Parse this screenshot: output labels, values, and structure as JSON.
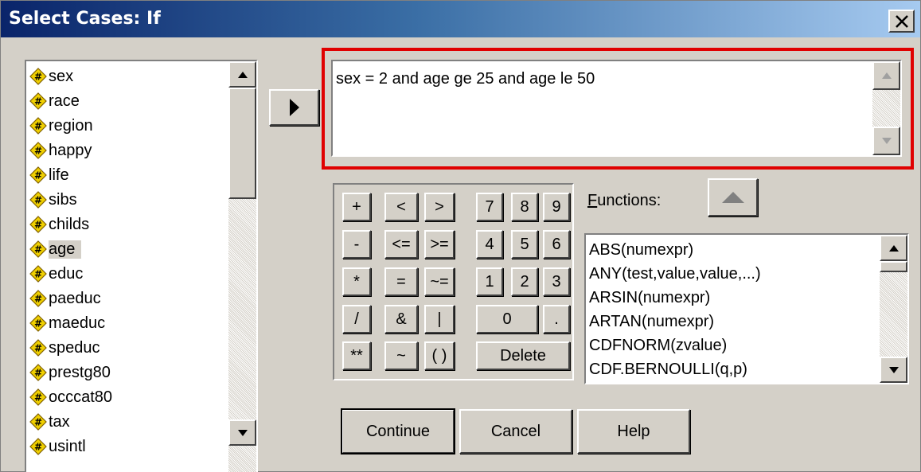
{
  "window": {
    "title": "Select Cases: If"
  },
  "variables": [
    "sex",
    "race",
    "region",
    "happy",
    "life",
    "sibs",
    "childs",
    "age",
    "educ",
    "paeduc",
    "maeduc",
    "speduc",
    "prestg80",
    "occcat80",
    "tax",
    "usintl"
  ],
  "selected_variable": "age",
  "expression": {
    "value": "sex = 2 and age ge 25 and age le 50"
  },
  "keypad": {
    "keys": [
      "+",
      "<",
      ">",
      "7",
      "8",
      "9",
      "-",
      "<=",
      ">=",
      "4",
      "5",
      "6",
      "*",
      "=",
      "~=",
      "1",
      "2",
      "3",
      "/",
      "&",
      "|",
      "0",
      ".",
      "**",
      "~",
      "( )",
      "Delete"
    ]
  },
  "functions": {
    "label": "Functions:",
    "items": [
      "ABS(numexpr)",
      "ANY(test,value,value,...)",
      "ARSIN(numexpr)",
      "ARTAN(numexpr)",
      "CDFNORM(zvalue)",
      "CDF.BERNOULLI(q,p)"
    ]
  },
  "buttons": {
    "continue": "Continue",
    "cancel": "Cancel",
    "help": "Help"
  },
  "colors": {
    "title_start": "#0a246a",
    "title_end": "#a6caf0",
    "highlight": "#e00000",
    "dialog_bg": "#d4d0c8"
  },
  "icons": {
    "variable": "numeric-variable-icon",
    "transfer": "right-triangle-icon",
    "close": "x-icon"
  }
}
